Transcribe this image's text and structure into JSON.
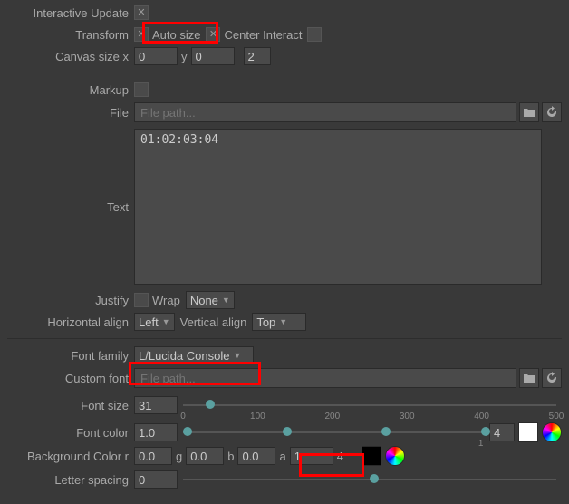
{
  "interactive_update": {
    "label": "Interactive Update",
    "checked": true
  },
  "transform": {
    "label": "Transform",
    "checked": true
  },
  "auto_size": {
    "label": "Auto size",
    "checked": true
  },
  "center_interact": {
    "label": "Center Interact",
    "checked": false
  },
  "canvas_size": {
    "label": "Canvas size",
    "x_label": "x",
    "x": "0",
    "y_label": "y",
    "y": "0",
    "z": "2"
  },
  "markup": {
    "label": "Markup",
    "checked": false
  },
  "file": {
    "label": "File",
    "placeholder": "File path..."
  },
  "text": {
    "label": "Text",
    "value": "01:02:03:04"
  },
  "justify": {
    "label": "Justify",
    "checked": false
  },
  "wrap": {
    "label": "Wrap",
    "value": "None"
  },
  "halign": {
    "label": "Horizontal align",
    "value": "Left"
  },
  "valign": {
    "label": "Vertical align",
    "value": "Top"
  },
  "font_family": {
    "label": "Font family",
    "value": "L/Lucida Console"
  },
  "custom_font": {
    "label": "Custom font",
    "placeholder": "File path..."
  },
  "font_size": {
    "label": "Font size",
    "value": "31",
    "ticks": [
      "0",
      "100",
      "200",
      "300",
      "400",
      "500"
    ]
  },
  "font_color": {
    "label": "Font color",
    "value": "1.0",
    "count": "4",
    "swatch": "#ffffff"
  },
  "bg_color": {
    "label": "Background Color",
    "r_label": "r",
    "r": "0.0",
    "g_label": "g",
    "g": "0.0",
    "b_label": "b",
    "b": "0.0",
    "a_label": "a",
    "a": "1",
    "count": "4",
    "swatch": "#000000"
  },
  "letter_spacing": {
    "label": "Letter spacing",
    "value": "0"
  }
}
